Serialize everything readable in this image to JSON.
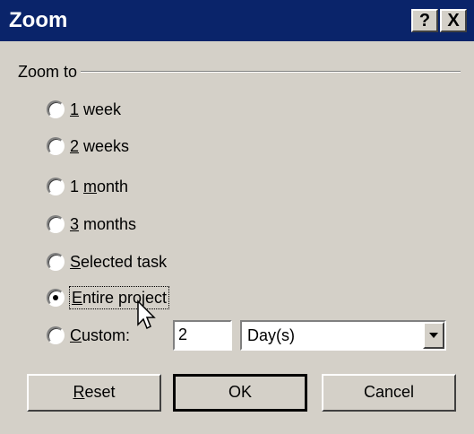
{
  "window": {
    "title": "Zoom",
    "help_glyph": "?",
    "close_glyph": "X"
  },
  "group": {
    "label": "Zoom to"
  },
  "options": [
    {
      "prefix": "",
      "mnemonic": "1",
      "suffix": " week",
      "checked": false
    },
    {
      "prefix": "",
      "mnemonic": "2",
      "suffix": " weeks",
      "checked": false
    },
    {
      "prefix": "1 ",
      "mnemonic": "m",
      "suffix": "onth",
      "checked": false
    },
    {
      "prefix": "",
      "mnemonic": "3",
      "suffix": " months",
      "checked": false
    },
    {
      "prefix": "",
      "mnemonic": "S",
      "suffix": "elected task",
      "checked": false
    },
    {
      "prefix": "",
      "mnemonic": "E",
      "suffix": "ntire project",
      "checked": true
    },
    {
      "prefix": "",
      "mnemonic": "C",
      "suffix": "ustom:",
      "checked": false
    }
  ],
  "custom": {
    "value": "2",
    "unit": "Day(s)"
  },
  "buttons": {
    "reset_mnemonic": "R",
    "reset_rest": "eset",
    "ok": "OK",
    "cancel": "Cancel"
  },
  "colors": {
    "titlebar": "#0a246a",
    "face": "#d4d0c8"
  }
}
